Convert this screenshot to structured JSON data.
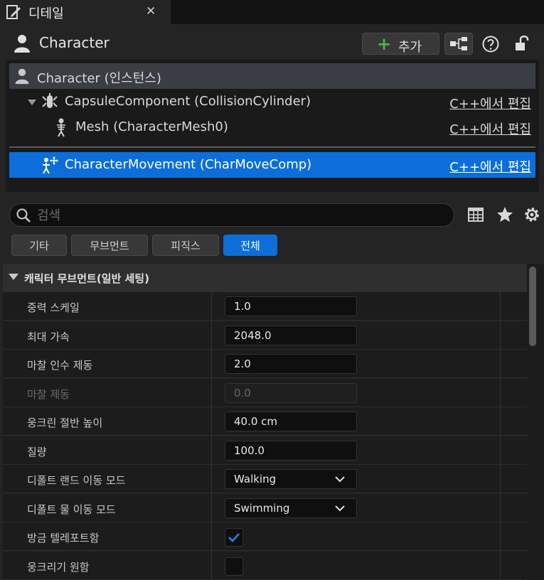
{
  "tab": {
    "title": "디테일",
    "close_glyph": "✕",
    "icon": "pencil-icon"
  },
  "header": {
    "actor_name": "Character",
    "add_button_label": "추가",
    "icons": [
      "person-icon",
      "plus-icon",
      "blueprint-icon",
      "help-icon",
      "lock-icon"
    ]
  },
  "tree": {
    "root": {
      "name": "Character (인스턴스)"
    },
    "items": [
      {
        "name": "CapsuleComponent (CollisionCylinder)",
        "edit": "C++에서 편집",
        "icon": "capsule-icon"
      },
      {
        "name": "Mesh (CharacterMesh0)",
        "edit": "C++에서 편집",
        "icon": "skeleton-icon"
      },
      {
        "name": "CharacterMovement (CharMoveComp)",
        "edit": "C++에서 편집",
        "icon": "movement-icon"
      }
    ]
  },
  "search": {
    "placeholder": "검색"
  },
  "toolbar_icons": [
    "table-icon",
    "star-icon",
    "gear-icon"
  ],
  "filters": [
    {
      "label": "기타",
      "active": false
    },
    {
      "label": "무브먼트",
      "active": false
    },
    {
      "label": "피직스",
      "active": false
    },
    {
      "label": "전체",
      "active": true
    }
  ],
  "category": {
    "label": "캐릭터 무브먼트(일반 세팅)"
  },
  "properties": [
    {
      "label": "중력 스케일",
      "type": "number",
      "value": "1.0"
    },
    {
      "label": "최대 가속",
      "type": "number",
      "value": "2048.0"
    },
    {
      "label": "마찰 인수 제동",
      "type": "number",
      "value": "2.0"
    },
    {
      "label": "마찰 제동",
      "type": "number",
      "value": "0.0",
      "disabled": true
    },
    {
      "label": "웅크린 절반 높이",
      "type": "number",
      "value": "40.0 cm"
    },
    {
      "label": "질량",
      "type": "number",
      "value": "100.0"
    },
    {
      "label": "디폴트 랜드 이동 모드",
      "type": "dropdown",
      "value": "Walking"
    },
    {
      "label": "디폴트 물 이동 모드",
      "type": "dropdown",
      "value": "Swimming"
    },
    {
      "label": "방금 텔레포트함",
      "type": "checkbox",
      "checked": true
    },
    {
      "label": "웅크리기 원함",
      "type": "checkbox",
      "checked": false
    }
  ],
  "colors": {
    "accent": "#0d6ed9",
    "panel": "#242424",
    "field": "#0f0f0f",
    "add_green": "#3fbd3f"
  }
}
